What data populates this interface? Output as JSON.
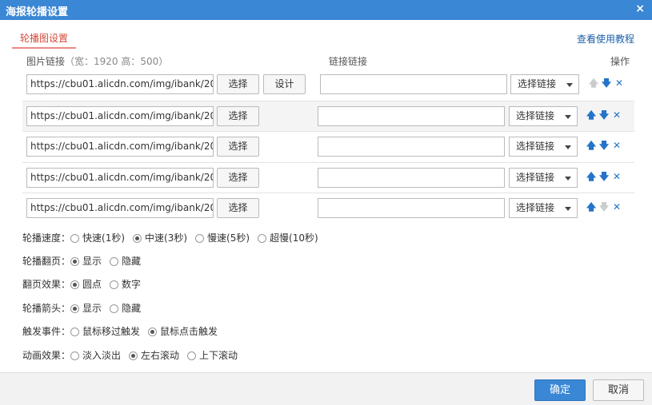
{
  "dialog": {
    "title": "海报轮播设置",
    "close": "×"
  },
  "tab": {
    "label": "轮播图设置"
  },
  "help_link": "查看使用教程",
  "headers": {
    "image_link": "图片链接",
    "image_hint": "（宽：1920 高：500）",
    "link": "链接链接",
    "ops": "操作"
  },
  "rows": [
    {
      "url": "https://cbu01.alicdn.com/img/ibank/20",
      "select_label": "选择",
      "design_label": "设计",
      "link": "",
      "link_select": "选择链接"
    },
    {
      "url": "https://cbu01.alicdn.com/img/ibank/20",
      "select_label": "选择",
      "link": "",
      "link_select": "选择链接"
    },
    {
      "url": "https://cbu01.alicdn.com/img/ibank/20",
      "select_label": "选择",
      "link": "",
      "link_select": "选择链接"
    },
    {
      "url": "https://cbu01.alicdn.com/img/ibank/20",
      "select_label": "选择",
      "link": "",
      "link_select": "选择链接"
    },
    {
      "url": "https://cbu01.alicdn.com/img/ibank/20",
      "select_label": "选择",
      "link": "",
      "link_select": "选择链接"
    }
  ],
  "icons": {
    "up": "🡅",
    "down": "🡇",
    "delete": "✕"
  },
  "options": {
    "speed": {
      "label": "轮播速度：",
      "choices": [
        "快速(1秒)",
        "中速(3秒)",
        "慢速(5秒)",
        "超慢(10秒)"
      ],
      "selected": 1
    },
    "paging": {
      "label": "轮播翻页：",
      "choices": [
        "显示",
        "隐藏"
      ],
      "selected": 0
    },
    "page_effect": {
      "label": "翻页效果：",
      "choices": [
        "圆点",
        "数字"
      ],
      "selected": 0
    },
    "arrows": {
      "label": "轮播箭头：",
      "choices": [
        "显示",
        "隐藏"
      ],
      "selected": 0
    },
    "trigger": {
      "label": "触发事件：",
      "choices": [
        "鼠标移过触发",
        "鼠标点击触发"
      ],
      "selected": 1
    },
    "animation": {
      "label": "动画效果：",
      "choices": [
        "淡入淡出",
        "左右滚动",
        "上下滚动"
      ],
      "selected": 1
    }
  },
  "footer": {
    "ok": "确定",
    "cancel": "取消"
  }
}
